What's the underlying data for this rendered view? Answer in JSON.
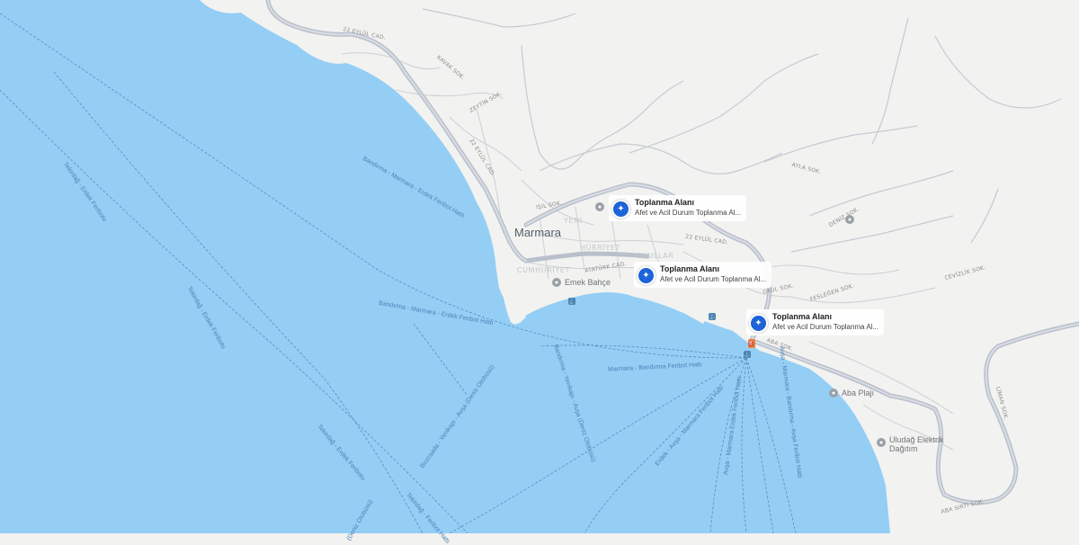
{
  "city": "Marmara",
  "districts": [
    "YENİ",
    "HÜRRİYET",
    "OKULLAR",
    "CUMHURİYET"
  ],
  "streets": {
    "eylul_north": "22 EYLÜL CAD.",
    "eylul_west": "22 EYLÜL CAD.",
    "eylul_east": "22 EYLÜL CAD.",
    "ataturk": "ATATÜRK CAD.",
    "aba": "ABA SOK.",
    "aba_sirti": "ABA SIRTI SOK.",
    "misc1": "KAVAK SOK.",
    "misc2": "ZEYTİN SOK.",
    "misc3": "IŞIL SOK.",
    "misc4": "AYLA SOK.",
    "misc5": "CEVİZLİK SOK.",
    "misc6": "FESLEĞEN SOK.",
    "misc7": "OKUL SOK.",
    "misc8": "DENİZ SOK.",
    "misc9": "LİMAN SOK."
  },
  "pois": {
    "emek_bahce": "Emek Bahçe",
    "aba_plaji": "Aba Plajı",
    "uludag_line1": "Uludağ Elektrik",
    "uludag_line2": "Dağıtım"
  },
  "assembly_points": [
    {
      "title": "Toplanma Alanı",
      "subtitle": "Afet ve Acil Durum Toplanma Al..."
    },
    {
      "title": "Toplanma Alanı",
      "subtitle": "Afet ve Acil Durum Toplanma Al..."
    },
    {
      "title": "Toplanma Alanı",
      "subtitle": "Afet ve Acil Durum Toplanma Al..."
    }
  ],
  "ferry_lines": {
    "l1": "Bandırma - Marmara - Erdek Feribot Hattı",
    "l2": "Bandırma - Marmara - Erdek Feribot Hattı",
    "l3": "Marmara - Bandırma Feribot Hattı",
    "l4": "Tekirdağ - Erdek Feribotu",
    "l5": "Tekirdağ - Erdek Feribotu",
    "l6": "Bozcaada - Yenikapı - Avşa (Deniz Otobüsü)",
    "l7": "Bandırma - Yenikapı - Avşa (Deniz Otobüsü)",
    "l8": "Tekirdağ - Erdek Feribotu",
    "l9": "Erdek - Avşa - Marmara Feribot Hattı",
    "l10": "Tekirdağ - Feribot Hattı",
    "l11": "Avşa - Marmara Erdek Feribot Hattı",
    "l12": "Avşa - Marmara - Bandırma - Avşa Feribot Hattı",
    "l13": "(Deniz Otobüsü)"
  },
  "colors": {
    "sea": "#94cef5",
    "land": "#f2f2f0",
    "main_road": "#b9c0cc",
    "ferry": "#5a8cc0",
    "assembly_badge": "#1d63d9"
  },
  "icons": {
    "assembly": "assembly-point-icon",
    "place": "place-pin-icon",
    "ferry_stop": "ferry-stop-icon",
    "fuel": "fuel-station-icon"
  }
}
